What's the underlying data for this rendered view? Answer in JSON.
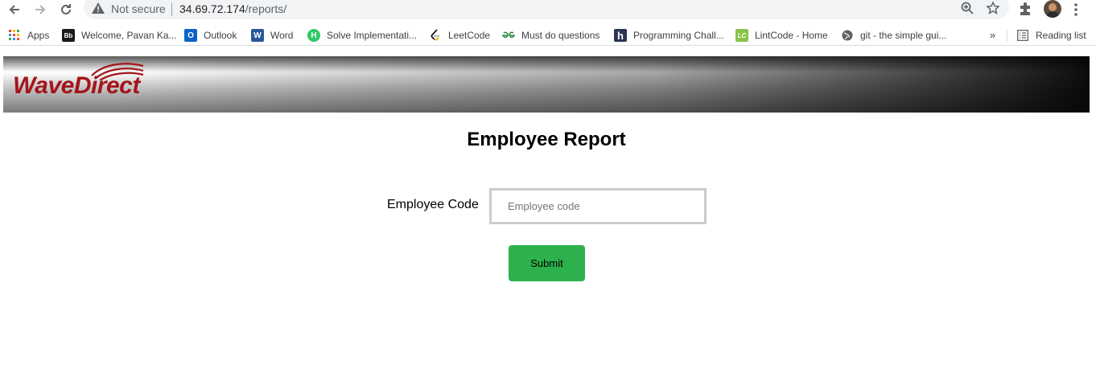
{
  "browser": {
    "security_text": "Not secure",
    "url_host": "34.69.72.174",
    "url_path": "/reports/"
  },
  "bookmarks": {
    "items": [
      {
        "label": "Apps",
        "icon": "apps-grid-icon"
      },
      {
        "label": "Welcome, Pavan Ka...",
        "icon": "blackboard-icon",
        "icon_text": "Bb",
        "color": "#1a1a1a"
      },
      {
        "label": "Outlook",
        "icon": "outlook-icon",
        "icon_text": "O",
        "color": "#0a64c7"
      },
      {
        "label": "Word",
        "icon": "word-icon",
        "icon_text": "W",
        "color": "#2b579a"
      },
      {
        "label": "Solve Implementati...",
        "icon": "hackerrank-icon",
        "icon_text": "H",
        "color": "#2ec866"
      },
      {
        "label": "LeetCode",
        "icon": "leetcode-icon"
      },
      {
        "label": "Must do questions",
        "icon": "geeksforgeeks-icon"
      },
      {
        "label": "Programming Chall...",
        "icon": "hackerearth-icon",
        "icon_text": "h",
        "color": "#2c3454"
      },
      {
        "label": "LintCode - Home",
        "icon": "lintcode-icon",
        "icon_text": "LC",
        "color": "#8bc34a"
      },
      {
        "label": "git - the simple gui...",
        "icon": "globe-icon"
      }
    ],
    "more": "»",
    "reading_list": "Reading list"
  },
  "header": {
    "logo_text": "WaveDirect"
  },
  "main": {
    "title": "Employee Report",
    "field_label": "Employee Code",
    "input_placeholder": "Employee code",
    "input_value": "",
    "submit_label": "Submit"
  },
  "colors": {
    "logo": "#a3151b",
    "submit": "#2db14c"
  }
}
